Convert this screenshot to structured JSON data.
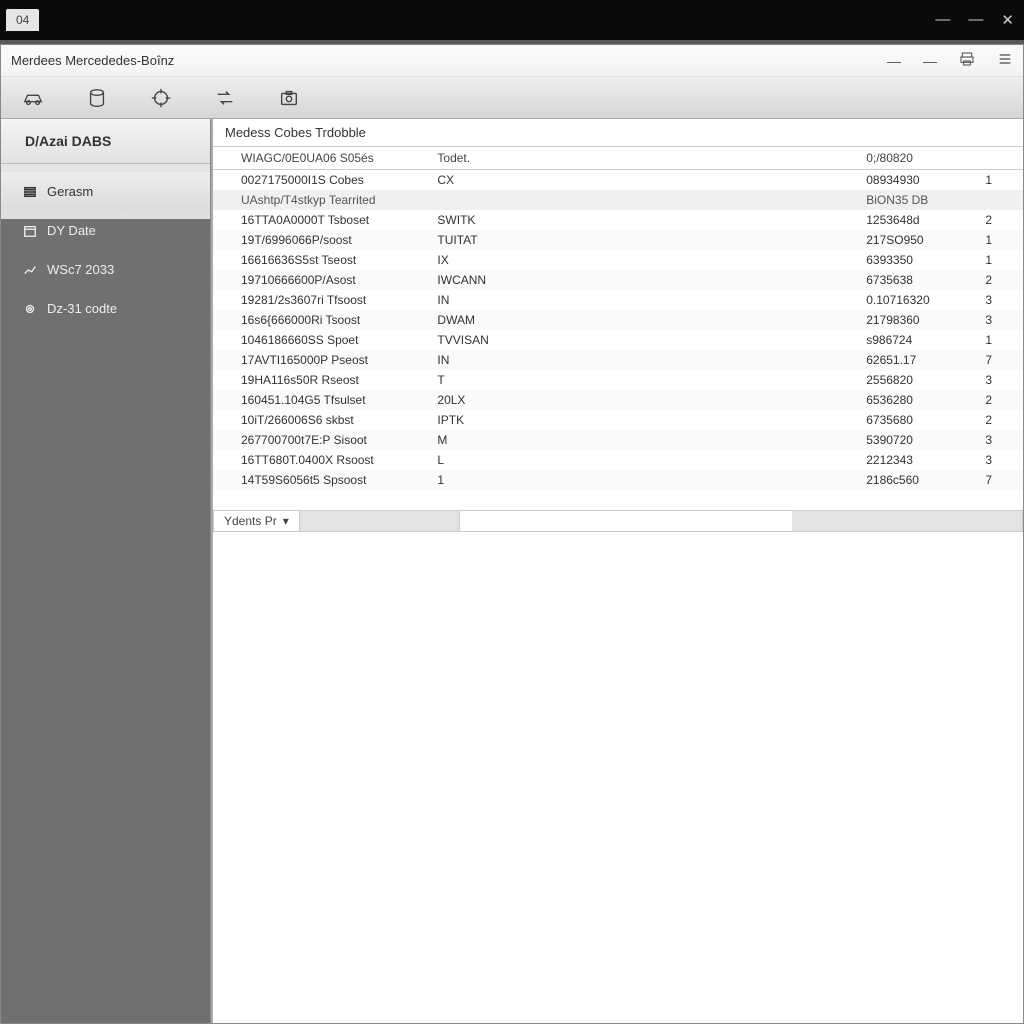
{
  "outer": {
    "tab_label": "04"
  },
  "window": {
    "title": "Merdees Mercededes-Boînz"
  },
  "sidebar": {
    "header": "D/Azai DABS",
    "items": [
      {
        "label": "Gerasm"
      },
      {
        "label": "DY Date"
      },
      {
        "label": "WSc7 2033"
      },
      {
        "label": "Dz-31 codte"
      }
    ]
  },
  "content": {
    "heading": "Medess Cobes Trdobble",
    "columns": [
      "WIAGC/0E0UA06 S05és",
      "Todet.",
      "0;/80820",
      ""
    ],
    "subheader_row": [
      "0027175000I1S Cobes",
      "CX",
      "08934930",
      "1"
    ],
    "section_row": [
      "UAshtp/T4stkyp Tearrited",
      "",
      "BiON35 DB",
      ""
    ],
    "rows": [
      [
        "16TTA0A0000T Tsboset",
        "SWITK",
        "1253648d",
        "2"
      ],
      [
        "19T/6996066P/soost",
        "TUITAT",
        "217SO950",
        "1"
      ],
      [
        "16616636S5st Tseost",
        "IX",
        "6393350",
        "1"
      ],
      [
        "19710666600P/Asost",
        "IWCANN",
        "6735638",
        "2"
      ],
      [
        "19281/2s3607ri Tfsoost",
        "IN",
        "0.10716320",
        "3"
      ],
      [
        "16s6{666000Ri Tsoost",
        "DWAM",
        "21798360",
        "3"
      ],
      [
        "1046186660SS Spoet",
        "TVVISAN",
        "s986724",
        "1"
      ],
      [
        "17AVTI165000P Pseost",
        "IN",
        "62651.17",
        "7"
      ],
      [
        "19HA116s50R Rseost",
        "T",
        "2556820",
        "3"
      ],
      [
        "160451.104G5 Tfsulset",
        "20LX",
        "6536280",
        "2"
      ],
      [
        "10iT/266006S6 skbst",
        "IPTK",
        "6735680",
        "2"
      ],
      [
        "267700700t7E:P Sisoot",
        "M",
        "5390720",
        "3"
      ],
      [
        "16TT680T.0400X Rsoost",
        "L",
        "2212343",
        "3"
      ],
      [
        "14T59S6056t5 Spsoost",
        "1",
        "2186c560",
        "7"
      ]
    ],
    "footer_select": "Ydents Pr"
  }
}
